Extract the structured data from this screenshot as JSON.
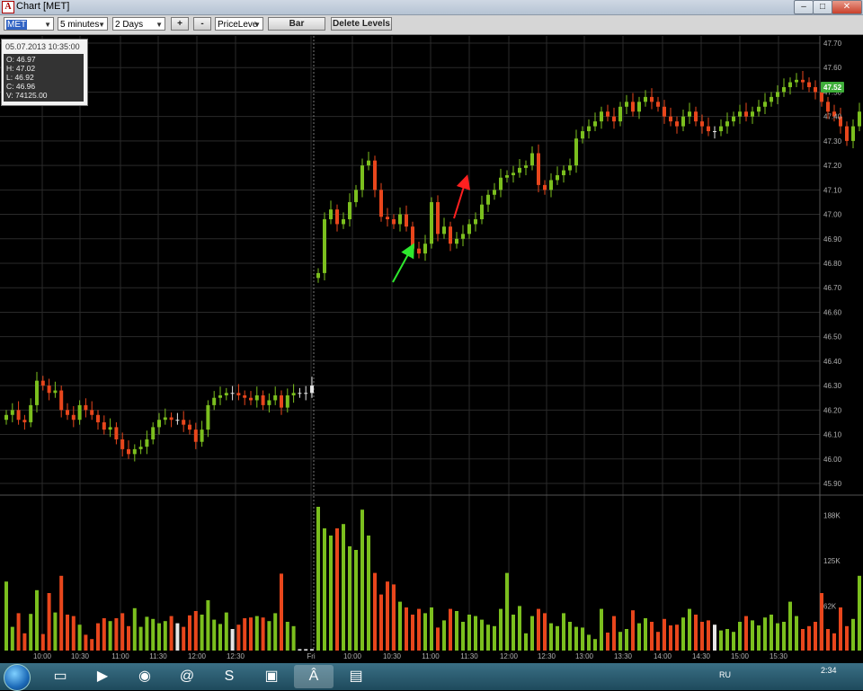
{
  "window": {
    "title": "Chart [MET]",
    "icon_letter": "A",
    "minimize": "–",
    "maximize": "□",
    "close": "✕"
  },
  "toolbar": {
    "symbol": "MET",
    "interval": "5 minutes",
    "range": "2 Days",
    "zoom_in": "+",
    "zoom_out": "-",
    "indicator": "PriceLeve",
    "bar_label": "Bar",
    "delete_levels_label": "Delete Levels"
  },
  "info": {
    "datetime": "05.07.2013 10:35:00",
    "o": "O: 46.97",
    "h": "H: 47.02",
    "l": "L: 46.92",
    "c": "C: 46.96",
    "v": "V: 74125.00"
  },
  "colors": {
    "up": "#7bbf1e",
    "down": "#e8461c",
    "neutral": "#e6e6e6",
    "last_price_bg": "#3fae3a",
    "grid": "#2a2a2a",
    "axis_text": "#b0b0b0"
  },
  "chart_data": {
    "type": "candlestick",
    "symbol": "MET",
    "interval": "5 minutes",
    "last_price": "47.52",
    "price_axis": {
      "ticks": [
        "47.70",
        "47.60",
        "47.50",
        "47.40",
        "47.30",
        "47.20",
        "47.10",
        "47.00",
        "46.90",
        "46.80",
        "46.70",
        "46.60",
        "46.50",
        "46.40",
        "46.30",
        "46.20",
        "46.10",
        "46.00",
        "45.90"
      ],
      "ylim": [
        45.85,
        47.75
      ]
    },
    "volume_axis": {
      "ticks": [
        "188K",
        "125K",
        "62K"
      ],
      "ylim": [
        0,
        240000
      ]
    },
    "time_labels": [
      "10:00",
      "10:30",
      "11:00",
      "11:30",
      "12:00",
      "12:30",
      "Fri",
      "10:00",
      "10:30",
      "11:00",
      "11:30",
      "12:00",
      "12:30",
      "13:00",
      "13:30",
      "14:00",
      "14:30",
      "15:00",
      "15:30"
    ],
    "sessions": [
      {
        "start_x": 7,
        "spacing": 6.8,
        "closes": [
          46.18,
          46.2,
          46.16,
          46.15,
          46.22,
          46.32,
          46.3,
          46.27,
          46.28,
          46.2,
          46.18,
          46.16,
          46.22,
          46.2,
          46.18,
          46.15,
          46.12,
          46.13,
          46.08,
          46.04,
          46.02,
          46.04,
          46.05,
          46.08,
          46.13,
          46.16,
          46.17,
          46.16,
          46.16,
          46.14,
          46.12,
          46.07,
          46.12,
          46.22,
          46.25,
          46.26,
          46.27,
          46.27,
          46.26,
          46.25,
          46.24,
          46.26,
          46.22,
          46.24,
          46.26,
          46.21,
          46.26,
          46.27,
          46.27,
          46.27,
          46.3
        ],
        "volumes": [
          96000,
          33000,
          52000,
          24000,
          51000,
          84000,
          23000,
          80000,
          53000,
          104000,
          50000,
          48000,
          36000,
          22000,
          16000,
          38000,
          45000,
          41000,
          45000,
          52000,
          34000,
          59000,
          33000,
          47000,
          44000,
          38000,
          41000,
          48000,
          38000,
          33000,
          49000,
          55000,
          50000,
          70000,
          43000,
          37000,
          53000,
          30000,
          36000,
          45000,
          46000,
          48000,
          46000,
          41000,
          52000,
          107000,
          40000,
          34000,
          2000,
          2000,
          2000
        ],
        "flat_from": 48
      },
      {
        "start_x": 354,
        "spacing": 7.0,
        "closes": [
          46.76,
          46.98,
          47.02,
          46.96,
          46.98,
          47.05,
          47.1,
          47.2,
          47.22,
          47.1,
          46.99,
          46.98,
          46.96,
          47.0,
          46.95,
          46.86,
          46.84,
          46.88,
          47.05,
          46.92,
          46.95,
          46.88,
          46.9,
          46.92,
          46.96,
          46.98,
          47.04,
          47.08,
          47.1,
          47.15,
          47.16,
          47.17,
          47.19,
          47.2,
          47.25,
          47.12,
          47.1,
          47.14,
          47.16,
          47.18,
          47.2,
          47.31,
          47.34,
          47.36,
          47.38,
          47.42,
          47.4,
          47.38,
          47.44,
          47.46,
          47.42,
          47.46,
          47.48,
          47.46,
          47.44,
          47.4,
          47.38,
          47.36,
          47.4,
          47.42,
          47.38,
          47.36,
          47.34,
          47.34,
          47.36,
          47.38,
          47.4,
          47.42,
          47.4,
          47.42,
          47.44,
          47.46,
          47.48,
          47.5,
          47.52,
          47.54,
          47.55,
          47.54,
          47.52,
          47.5,
          47.46,
          47.42,
          47.4,
          47.36,
          47.3,
          47.36,
          47.42,
          47.44,
          47.4,
          47.46,
          47.52
        ],
        "volumes": [
          200000,
          170000,
          160000,
          170000,
          176000,
          145000,
          140000,
          196000,
          160000,
          108000,
          78000,
          96000,
          92000,
          68000,
          60000,
          50000,
          58000,
          52000,
          60000,
          32000,
          42000,
          58000,
          55000,
          40000,
          50000,
          48000,
          43000,
          36000,
          34000,
          58000,
          108000,
          50000,
          62000,
          24000,
          48000,
          58000,
          52000,
          38000,
          34000,
          52000,
          40000,
          33000,
          32000,
          22000,
          16000,
          58000,
          25000,
          48000,
          26000,
          30000,
          56000,
          38000,
          45000,
          40000,
          26000,
          44000,
          35000,
          36000,
          46000,
          58000,
          50000,
          40000,
          42000,
          36000,
          28000,
          30000,
          26000,
          40000,
          48000,
          42000,
          35000,
          46000,
          50000,
          38000,
          40000,
          68000,
          48000,
          30000,
          34000,
          40000,
          80000,
          30000,
          24000,
          60000,
          34000,
          44000,
          104000,
          48000,
          30000,
          116000,
          185000
        ]
      }
    ]
  }
}
